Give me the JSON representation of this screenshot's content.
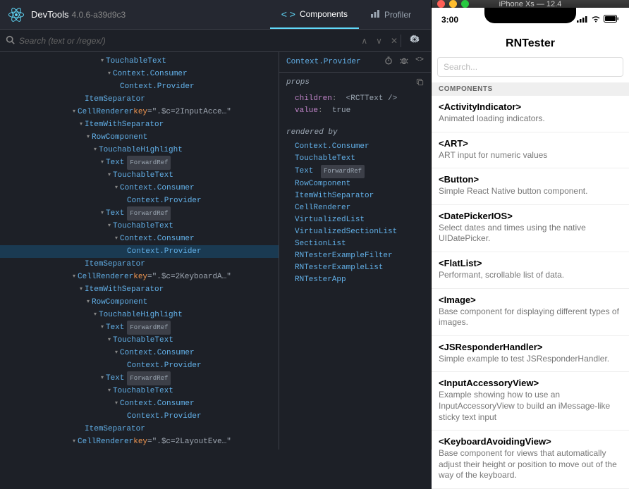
{
  "devtools": {
    "title": "DevTools",
    "version": "4.0.6-a39d9c3",
    "tabs": {
      "components": "Components",
      "profiler": "Profiler"
    },
    "search_placeholder": "Search (text or /regex/)",
    "tree": [
      {
        "depth": 6,
        "name": "TouchableText",
        "caret": true
      },
      {
        "depth": 7,
        "name": "Context.Consumer",
        "caret": true
      },
      {
        "depth": 8,
        "name": "Context.Provider"
      },
      {
        "depth": 3,
        "name": "ItemSeparator"
      },
      {
        "depth": 2,
        "name": "CellRenderer",
        "caret": true,
        "key": "\".$c=2InputAcce…\""
      },
      {
        "depth": 3,
        "name": "ItemWithSeparator",
        "caret": true
      },
      {
        "depth": 4,
        "name": "RowComponent",
        "caret": true
      },
      {
        "depth": 5,
        "name": "TouchableHighlight",
        "caret": true
      },
      {
        "depth": 6,
        "name": "Text",
        "caret": true,
        "badge": "ForwardRef"
      },
      {
        "depth": 7,
        "name": "TouchableText",
        "caret": true
      },
      {
        "depth": 8,
        "name": "Context.Consumer",
        "caret": true
      },
      {
        "depth": 9,
        "name": "Context.Provider"
      },
      {
        "depth": 6,
        "name": "Text",
        "caret": true,
        "badge": "ForwardRef"
      },
      {
        "depth": 7,
        "name": "TouchableText",
        "caret": true
      },
      {
        "depth": 8,
        "name": "Context.Consumer",
        "caret": true
      },
      {
        "depth": 9,
        "name": "Context.Provider",
        "selected": true
      },
      {
        "depth": 3,
        "name": "ItemSeparator"
      },
      {
        "depth": 2,
        "name": "CellRenderer",
        "caret": true,
        "key": "\".$c=2KeyboardA…\""
      },
      {
        "depth": 3,
        "name": "ItemWithSeparator",
        "caret": true
      },
      {
        "depth": 4,
        "name": "RowComponent",
        "caret": true
      },
      {
        "depth": 5,
        "name": "TouchableHighlight",
        "caret": true
      },
      {
        "depth": 6,
        "name": "Text",
        "caret": true,
        "badge": "ForwardRef"
      },
      {
        "depth": 7,
        "name": "TouchableText",
        "caret": true
      },
      {
        "depth": 8,
        "name": "Context.Consumer",
        "caret": true
      },
      {
        "depth": 9,
        "name": "Context.Provider"
      },
      {
        "depth": 6,
        "name": "Text",
        "caret": true,
        "badge": "ForwardRef"
      },
      {
        "depth": 7,
        "name": "TouchableText",
        "caret": true
      },
      {
        "depth": 8,
        "name": "Context.Consumer",
        "caret": true
      },
      {
        "depth": 9,
        "name": "Context.Provider"
      },
      {
        "depth": 3,
        "name": "ItemSeparator"
      },
      {
        "depth": 2,
        "name": "CellRenderer",
        "caret": true,
        "key": "\".$c=2LayoutEve…\""
      }
    ],
    "detail": {
      "title": "Context.Provider",
      "props_label": "props",
      "props": [
        {
          "key": "children",
          "val": "<RCTText />"
        },
        {
          "key": "value",
          "val": "true"
        }
      ],
      "rendered_label": "rendered by",
      "rendered": [
        {
          "name": "Context.Consumer"
        },
        {
          "name": "TouchableText"
        },
        {
          "name": "Text",
          "badge": "ForwardRef"
        },
        {
          "name": "RowComponent"
        },
        {
          "name": "ItemWithSeparator"
        },
        {
          "name": "CellRenderer"
        },
        {
          "name": "VirtualizedList"
        },
        {
          "name": "VirtualizedSectionList"
        },
        {
          "name": "SectionList"
        },
        {
          "name": "RNTesterExampleFilter"
        },
        {
          "name": "RNTesterExampleList"
        },
        {
          "name": "RNTesterApp"
        }
      ]
    }
  },
  "simulator": {
    "window_title": "iPhone Xs — 12.4",
    "time": "3:00",
    "app_title": "RNTester",
    "search_placeholder": "Search...",
    "section_label": "COMPONENTS",
    "items": [
      {
        "title": "<ActivityIndicator>",
        "desc": "Animated loading indicators."
      },
      {
        "title": "<ART>",
        "desc": "ART input for numeric values"
      },
      {
        "title": "<Button>",
        "desc": "Simple React Native button component."
      },
      {
        "title": "<DatePickerIOS>",
        "desc": "Select dates and times using the native UIDatePicker."
      },
      {
        "title": "<FlatList>",
        "desc": "Performant, scrollable list of data."
      },
      {
        "title": "<Image>",
        "desc": "Base component for displaying different types of images."
      },
      {
        "title": "<JSResponderHandler>",
        "desc": "Simple example to test JSResponderHandler."
      },
      {
        "title": "<InputAccessoryView>",
        "desc": "Example showing how to use an InputAccessoryView to build an iMessage-like sticky text input"
      },
      {
        "title": "<KeyboardAvoidingView>",
        "desc": "Base component for views that automatically adjust their height or position to move out of the way of the keyboard."
      }
    ]
  }
}
